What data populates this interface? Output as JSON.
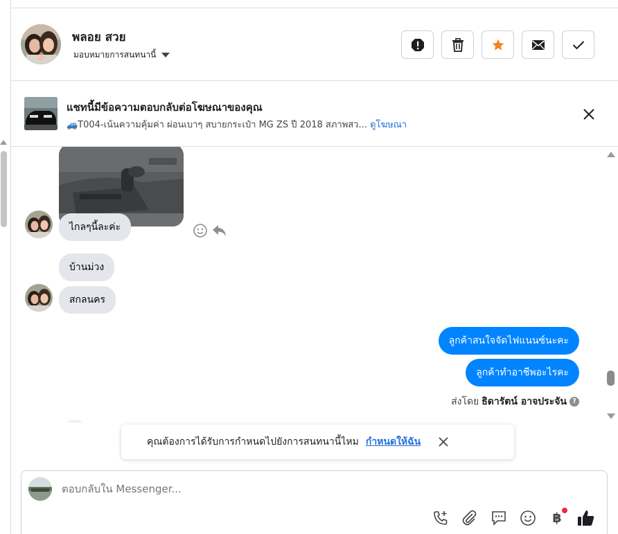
{
  "contact": {
    "name": "พลอย สวย",
    "assign_label": "มอบหมายการสนทนานี้"
  },
  "header_actions": [
    {
      "name": "spam-button",
      "icon": "alert-octagon-icon"
    },
    {
      "name": "delete-button",
      "icon": "trash-icon"
    },
    {
      "name": "star-button",
      "icon": "star-icon"
    },
    {
      "name": "mark-unread-button",
      "icon": "envelope-icon"
    },
    {
      "name": "mark-done-button",
      "icon": "check-icon"
    }
  ],
  "ad_banner": {
    "title": "แชทนี้มีข้อความตอบกลับต่อโฆษณาของคุณ",
    "subtitle": "🚙T004-เน้นความคุ้มค่า ผ่อนเบาๆ สบายกระเป๋า MG ZS ปี 2018 สภาพสว...",
    "link": "ดูโฆษณา"
  },
  "messages": {
    "in_1": "ไกลๆนี้ละค่ะ",
    "in_2": "บ้านม่วง",
    "in_3": "สกลนคร",
    "out_1": "ลูกค้าสนใจจัดไฟแนนซ์นะคะ",
    "out_2": "ลูกค้าทำอาชีพอะไรคะ",
    "sent_by_prefix": "ส่งโดย",
    "sent_by_name": "ธิดารัตน์ อาจประจัน"
  },
  "toast": {
    "text": "คุณต้องการได้รับการกำหนดไปยังการสนทนานี้ไหม",
    "action": "กำหนดให้ฉัน"
  },
  "composer": {
    "placeholder": "ตอบกลับใน Messenger...",
    "baht_symbol": "฿"
  },
  "colors": {
    "accent": "#0084ff",
    "link": "#216fdb",
    "star": "#f5821f",
    "incoming_bubble": "#e4e6eb"
  }
}
